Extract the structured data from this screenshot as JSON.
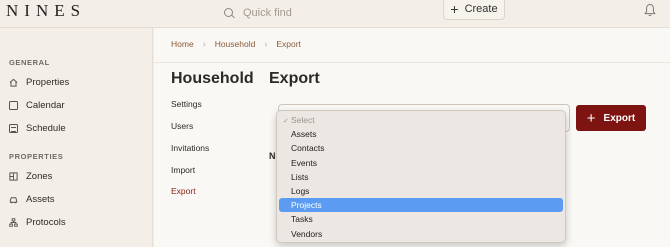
{
  "topbar": {
    "logo": "NINES",
    "search_placeholder": "Quick find",
    "create_label": "Create"
  },
  "sidebar": {
    "sections": [
      {
        "title": "GENERAL",
        "items": [
          {
            "label": "Properties",
            "icon": "house-icon"
          },
          {
            "label": "Calendar",
            "icon": "calendar-icon"
          },
          {
            "label": "Schedule",
            "icon": "schedule-icon"
          }
        ]
      },
      {
        "title": "PROPERTIES",
        "items": [
          {
            "label": "Zones",
            "icon": "zones-icon"
          },
          {
            "label": "Assets",
            "icon": "car-icon"
          },
          {
            "label": "Protocols",
            "icon": "hierarchy-icon"
          }
        ]
      }
    ]
  },
  "breadcrumb": [
    "Home",
    "Household",
    "Export"
  ],
  "page": {
    "section_title": "Household",
    "title": "Export",
    "subnav": [
      "Settings",
      "Users",
      "Invitations",
      "Import",
      "Export"
    ],
    "active_subnav": "Export",
    "export_button": "Export",
    "partial_text": "N"
  },
  "dropdown": {
    "placeholder": "Select",
    "options": [
      "Assets",
      "Contacts",
      "Events",
      "Lists",
      "Logs",
      "Projects",
      "Tasks",
      "Vendors"
    ],
    "highlighted": "Projects"
  },
  "colors": {
    "accent": "#7d1411",
    "highlight": "#5b9cf2",
    "link": "#8a5a3a"
  }
}
